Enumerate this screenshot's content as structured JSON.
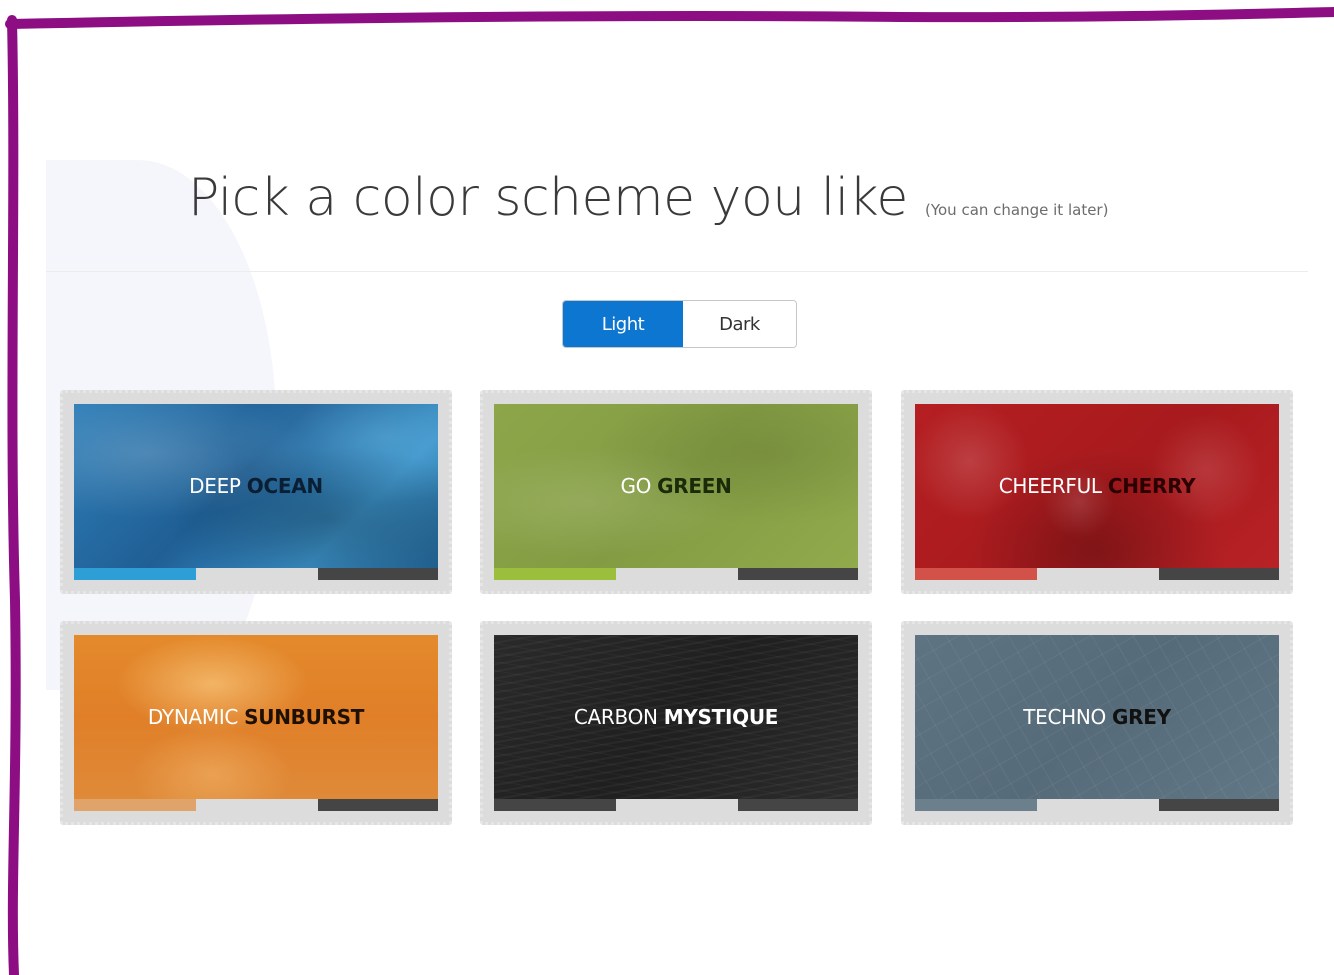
{
  "header": {
    "title": "Pick a color scheme you like",
    "subtitle": "(You can change it later)"
  },
  "mode_toggle": {
    "options": [
      "Light",
      "Dark"
    ],
    "selected": "Light"
  },
  "schemes": [
    {
      "name_light": "DEEP",
      "name_bold": "OCEAN",
      "accent_color": "#0a1f33",
      "swatches": [
        "#2e9ed6",
        "#dcdcdc",
        "#454545"
      ]
    },
    {
      "name_light": "GO",
      "name_bold": "GREEN",
      "accent_color": "#1b2a08",
      "swatches": [
        "#9bbf3c",
        "#dcdcdc",
        "#454545"
      ]
    },
    {
      "name_light": "CHEERFUL",
      "name_bold": "CHERRY",
      "accent_color": "#2b0000",
      "swatches": [
        "#d2524a",
        "#dcdcdc",
        "#454545"
      ]
    },
    {
      "name_light": "DYNAMIC",
      "name_bold": "SUNBURST",
      "accent_color": "#1e1000",
      "swatches": [
        "#e0a46a",
        "#dcdcdc",
        "#454545"
      ]
    },
    {
      "name_light": "CARBON",
      "name_bold": "MYSTIQUE",
      "accent_color": "#ffffff",
      "swatches": [
        "#454545",
        "#dcdcdc",
        "#454545"
      ]
    },
    {
      "name_light": "TECHNO",
      "name_bold": "GREY",
      "accent_color": "#111111",
      "swatches": [
        "#6b7f8c",
        "#dcdcdc",
        "#454545"
      ]
    }
  ],
  "colors": {
    "frame_border": "#8d0d83",
    "toggle_active_bg": "#0d76d1"
  }
}
